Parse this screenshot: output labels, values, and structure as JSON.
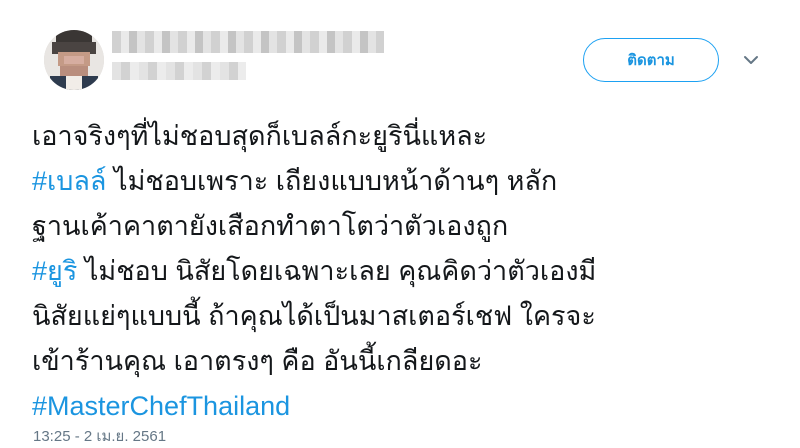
{
  "follow_button": {
    "label": "ติดตาม"
  },
  "tweet": {
    "line1": "เอาจริงๆที่ไม่ชอบสุดก็เบลล์กะยูรินี่แหละ",
    "line2_tag": "#เบลล์",
    "line2_text": " ไม่ชอบเพราะ เถียงแบบหน้าด้านๆ หลัก",
    "line3": "ฐานเค้าคาตายังเสือกทำตาโตว่าตัวเองถูก",
    "line4_tag": "#ยูริ",
    "line4_text": " ไม่ชอบ นิสัยโดยเฉพาะเลย คุณคิดว่าตัวเองมี",
    "line5": "นิสัยแย่ๆแบบนี้ ถ้าคุณได้เป็นมาสเตอร์เชฟ ใครจะ",
    "line6": "เข้าร้านคุณ เอาตรงๆ คือ อันนี้เกลียดอะ",
    "line7_tag": "#MasterChefThailand"
  },
  "timestamp": "13:25 - 2 เม.ย. 2561",
  "icons": {
    "menu": "chevron-down-icon"
  },
  "colors": {
    "accent": "#1da1f2",
    "link": "#1b95e0",
    "text": "#14171a",
    "muted": "#657786"
  }
}
